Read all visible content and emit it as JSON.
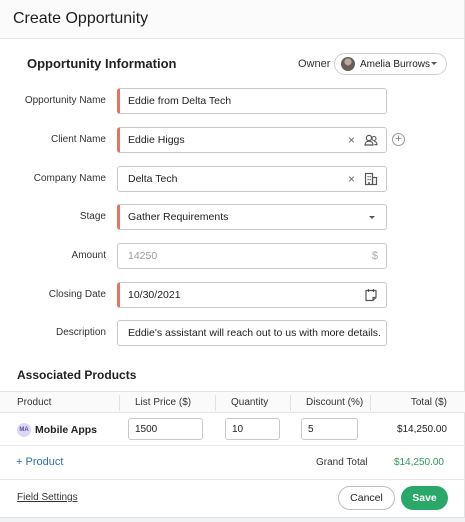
{
  "dialog": {
    "title": "Create Opportunity"
  },
  "section": {
    "title": "Opportunity Information"
  },
  "owner": {
    "label": "Owner",
    "name": "Amelia Burrows"
  },
  "fields": {
    "opportunity_name": {
      "label": "Opportunity Name",
      "value": "Eddie from Delta Tech"
    },
    "client_name": {
      "label": "Client Name",
      "value": "Eddie Higgs"
    },
    "company_name": {
      "label": "Company Name",
      "value": "Delta Tech"
    },
    "stage": {
      "label": "Stage",
      "value": "Gather Requirements"
    },
    "amount": {
      "label": "Amount",
      "placeholder": "14250",
      "currency_symbol": "$"
    },
    "closing_date": {
      "label": "Closing Date",
      "value": "10/30/2021"
    },
    "description": {
      "label": "Description",
      "value": "Eddie's assistant will reach out to us with more details."
    }
  },
  "products": {
    "title": "Associated Products",
    "columns": [
      "Product",
      "List Price ($)",
      "Quantity",
      "Discount (%)",
      "Total ($)"
    ],
    "rows": [
      {
        "initials": "MA",
        "name": "Mobile Apps",
        "list_price": "1500",
        "quantity": "10",
        "discount": "5",
        "total": "$14,250.00"
      }
    ],
    "add_label": "+ Product",
    "grand_total_label": "Grand Total",
    "grand_total": "$14,250.00"
  },
  "footer": {
    "field_settings": "Field Settings",
    "cancel": "Cancel",
    "save": "Save"
  },
  "colors": {
    "required_accent": "#e6735c",
    "save_button": "#2aa86a",
    "grand_total": "#2e9a56",
    "link": "#2e6fb3"
  }
}
